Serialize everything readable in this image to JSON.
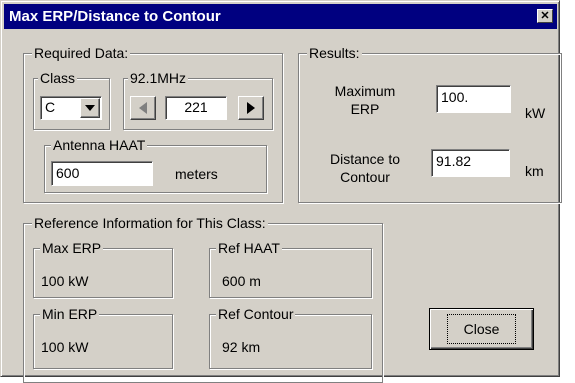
{
  "window": {
    "title": "Max ERP/Distance to Contour",
    "close_glyph": "✕"
  },
  "required": {
    "title": "Required Data:",
    "class_label": "Class",
    "class_value": "C",
    "freq_label": "92.1MHz",
    "channel_value": "221",
    "haat_label": "Antenna HAAT",
    "haat_value": "600",
    "haat_unit": "meters"
  },
  "results": {
    "title": "Results:",
    "max_erp_label": "Maximum\nERP",
    "max_erp_value": "100.",
    "max_erp_unit": "kW",
    "distance_label": "Distance to\nContour",
    "distance_value": "91.82",
    "distance_unit": "km"
  },
  "reference": {
    "title": "Reference Information for This Class:",
    "max_erp_label": "Max ERP",
    "max_erp_value": "100 kW",
    "ref_haat_label": "Ref HAAT",
    "ref_haat_value": "600 m",
    "min_erp_label": "Min ERP",
    "min_erp_value": "100 kW",
    "ref_contour_label": "Ref Contour",
    "ref_contour_value": "92 km"
  },
  "buttons": {
    "close_label": "Close"
  },
  "icons": {
    "dropdown": "chevron-down-icon",
    "prev": "arrow-left-icon",
    "next": "arrow-right-icon"
  },
  "colors": {
    "titlebar": "#000080",
    "dialog_face": "#d4d0c8"
  }
}
